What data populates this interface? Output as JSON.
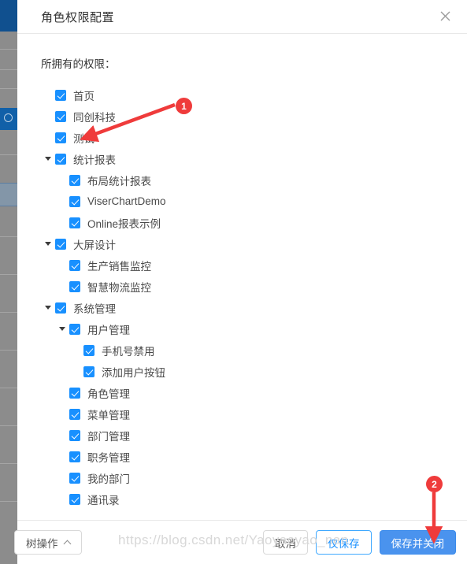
{
  "dialog": {
    "title": "角色权限配置",
    "close_icon": "close-icon",
    "permissions_label": "所拥有的权限："
  },
  "tree": {
    "nodes": [
      {
        "label": "首页",
        "level": 0,
        "checked": true,
        "expandable": false
      },
      {
        "label": "同创科技",
        "level": 0,
        "checked": true,
        "expandable": false
      },
      {
        "label": "测试",
        "level": 0,
        "checked": true,
        "expandable": false
      },
      {
        "label": "统计报表",
        "level": 0,
        "checked": true,
        "expandable": true
      },
      {
        "label": "布局统计报表",
        "level": 1,
        "checked": true,
        "expandable": false
      },
      {
        "label": "ViserChartDemo",
        "level": 1,
        "checked": true,
        "expandable": false
      },
      {
        "label": "Online报表示例",
        "level": 1,
        "checked": true,
        "expandable": false
      },
      {
        "label": "大屏设计",
        "level": 0,
        "checked": true,
        "expandable": true
      },
      {
        "label": "生产销售监控",
        "level": 1,
        "checked": true,
        "expandable": false
      },
      {
        "label": "智慧物流监控",
        "level": 1,
        "checked": true,
        "expandable": false
      },
      {
        "label": "系统管理",
        "level": 0,
        "checked": true,
        "expandable": true
      },
      {
        "label": "用户管理",
        "level": 1,
        "checked": true,
        "expandable": true
      },
      {
        "label": "手机号禁用",
        "level": 2,
        "checked": true,
        "expandable": false
      },
      {
        "label": "添加用户按钮",
        "level": 2,
        "checked": true,
        "expandable": false
      },
      {
        "label": "角色管理",
        "level": 1,
        "checked": true,
        "expandable": false
      },
      {
        "label": "菜单管理",
        "level": 1,
        "checked": true,
        "expandable": false
      },
      {
        "label": "部门管理",
        "level": 1,
        "checked": true,
        "expandable": false
      },
      {
        "label": "职务管理",
        "level": 1,
        "checked": true,
        "expandable": false
      },
      {
        "label": "我的部门",
        "level": 1,
        "checked": true,
        "expandable": false
      },
      {
        "label": "通讯录",
        "level": 1,
        "checked": true,
        "expandable": false
      }
    ]
  },
  "footer": {
    "tree_action_label": "树操作",
    "tree_action_chevron": "chevron-up-icon",
    "cancel_label": "取消",
    "save_only_label": "仅保存",
    "save_close_label": "保存并关闭"
  },
  "watermark": {
    "text": "https://blog.csdn.net/Yaoyaoyao_nan"
  },
  "annotations": [
    {
      "id": "1",
      "label": "1"
    },
    {
      "id": "2",
      "label": "2"
    }
  ],
  "colors": {
    "primary": "#4a93ee",
    "checkbox": "#1890ff",
    "link": "#1890ff",
    "annotation": "#ef3b3b",
    "bg_header": "#10508f"
  }
}
